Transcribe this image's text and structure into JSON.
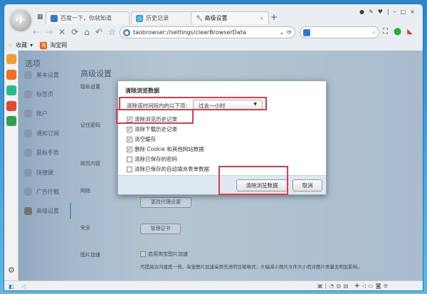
{
  "tabs": [
    {
      "label": "百度一下，你就知道"
    },
    {
      "label": "历史记录"
    },
    {
      "label": "高级设置",
      "active": true
    }
  ],
  "address": {
    "url": "taobrowser://settings/clearBrowserData"
  },
  "bookmarks": [
    {
      "label": "收藏"
    },
    {
      "label": "淘宝网"
    }
  ],
  "sidebar": {
    "title": "选项",
    "items": [
      {
        "label": "基本设置"
      },
      {
        "label": "标签页"
      },
      {
        "label": "账户"
      },
      {
        "label": "通知订阅"
      },
      {
        "label": "鼠标手势"
      },
      {
        "label": "快捷键"
      },
      {
        "label": "广告拦截"
      },
      {
        "label": "高级设置",
        "active": true
      }
    ]
  },
  "page": {
    "title": "高级设置",
    "sections": {
      "privacy": "隐私设置",
      "password": "记住密码",
      "web": "网页内容",
      "network": "网络",
      "security": "安全",
      "image": "图片加速"
    },
    "proxy_button": "更改代理设置",
    "cert_button": "管理证书",
    "image_checkbox": "启用淘宝图片加速",
    "image_desc": "可提高访问速度一倍，淘宝图片加速采用先进的压缩格式，大幅减小图片文件大小而对图片质量无明显影响。"
  },
  "dialog": {
    "title": "清除浏览数据",
    "range_label": "清除该时间段内的以下项：",
    "range_value": "过去一小时",
    "options": [
      {
        "label": "清除浏览历史记录",
        "checked": true
      },
      {
        "label": "清除下载历史记录",
        "checked": true
      },
      {
        "label": "清空缓存",
        "checked": true
      },
      {
        "label": "删除 Cookie 和其他网站数据",
        "checked": true
      },
      {
        "label": "清除已保存的密码",
        "checked": false
      },
      {
        "label": "清除已保存的自动填充表单数据",
        "checked": false
      }
    ],
    "confirm": "清除浏览数据",
    "cancel": "取消"
  },
  "colors": {
    "highlight": "#e43a4a",
    "accent": "#3b7bd4"
  }
}
